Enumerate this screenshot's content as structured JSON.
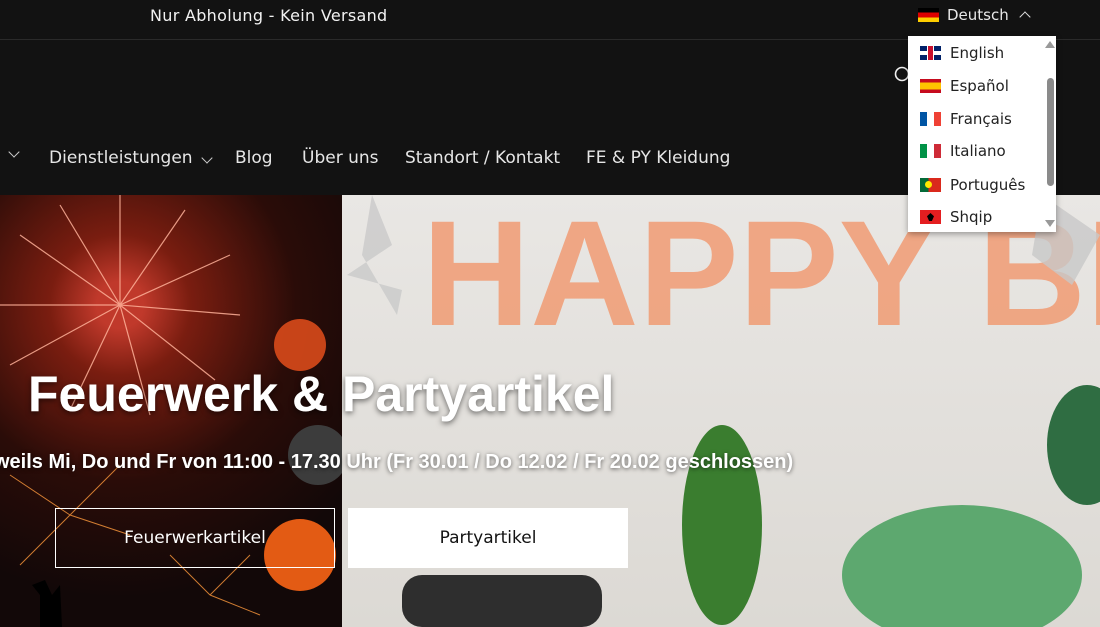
{
  "announcement": {
    "text": "Nur Abholung - Kein Versand"
  },
  "language": {
    "current": "Deutsch",
    "current_flag": "de-flag-icon",
    "options": [
      {
        "label": "English",
        "flag": "gb-flag-icon"
      },
      {
        "label": "Español",
        "flag": "es-flag-icon"
      },
      {
        "label": "Français",
        "flag": "fr-flag-icon"
      },
      {
        "label": "Italiano",
        "flag": "it-flag-icon"
      },
      {
        "label": "Português",
        "flag": "pt-flag-icon"
      },
      {
        "label": "Shqip",
        "flag": "al-flag-icon"
      }
    ]
  },
  "header": {
    "search_icon": "search-icon"
  },
  "nav": {
    "items": [
      {
        "label": "Dienstleistungen",
        "has_submenu": true
      },
      {
        "label": "Blog"
      },
      {
        "label": "Über uns"
      },
      {
        "label": "Standort / Kontakt"
      },
      {
        "label": "FE & PY Kleidung"
      }
    ]
  },
  "hero": {
    "title": "Feuerwerk & Partyartikel",
    "subtitle": "weils Mi, Do und Fr von 11:00 - 17.30 Uhr (Fr 30.01 / Do 12.02 / Fr 20.02 geschlossen)",
    "buttons": [
      {
        "label": "Feuerwerkartikel",
        "style": "outline"
      },
      {
        "label": "Partyartikel",
        "style": "solid"
      }
    ],
    "balloon_text": "HAPPY BIRTHDAY"
  },
  "colors": {
    "background": "#121212",
    "text": "#ffffff",
    "dropdown_bg": "#ffffff"
  }
}
